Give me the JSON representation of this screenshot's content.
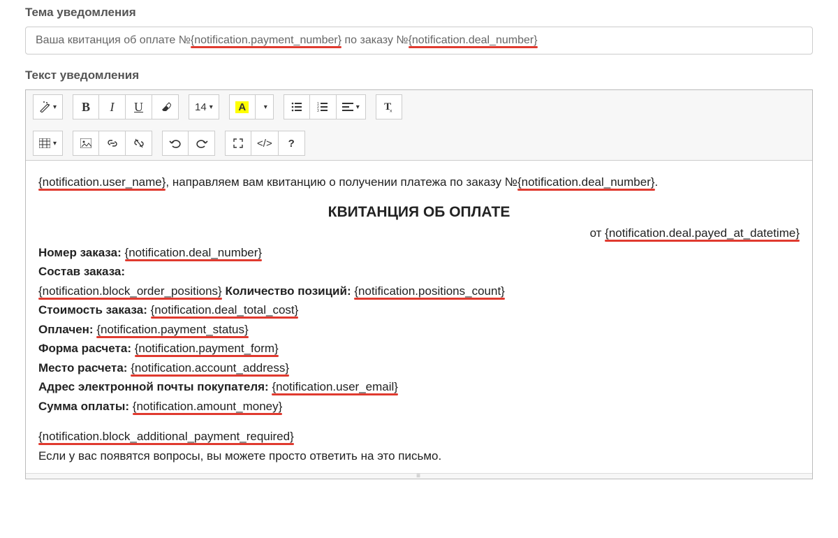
{
  "labels": {
    "subject": "Тема уведомления",
    "body": "Текст уведомления"
  },
  "subject": {
    "pre1": "Ваша квитанция об оплате №",
    "var1": "{notification.payment_number}",
    "mid": " по заказу №",
    "var2": "{notification.deal_number}"
  },
  "toolbar": {
    "fontsize": "14",
    "fontcolor_letter": "A",
    "code": "</>",
    "help": "?",
    "clear_t": "T"
  },
  "body": {
    "greet_var": "{notification.user_name}",
    "greet_rest": ", направляем вам квитанцию о получении платежа по заказу №",
    "greet_var2": "{notification.deal_number}",
    "greet_dot": ".",
    "title": "КВИТАНЦИЯ ОБ ОПЛАТЕ",
    "date_pre": "от ",
    "date_var": "{notification.deal.payed_at_datetime}",
    "rows": {
      "r1_lbl": "Номер заказа:",
      "r1_var": "{notification.deal_number}",
      "r2_lbl": "Состав заказа:",
      "r3_var": "{notification.block_order_positions}",
      "r3_lbl2": "Количество позиций:",
      "r3_var2": "{notification.positions_count}",
      "r4_lbl": "Стоимость заказа:",
      "r4_var": "{notification.deal_total_cost}",
      "r5_lbl": "Оплачен:",
      "r5_var": "{notification.payment_status}",
      "r6_lbl": "Форма расчета:",
      "r6_var": "{notification.payment_form}",
      "r7_lbl": "Место расчета:",
      "r7_var": "{notification.account_address}",
      "r8_lbl": "Адрес электронной почты покупателя:",
      "r8_var": "{notification.user_email}",
      "r9_lbl": "Сумма оплаты:",
      "r9_var": "{notification.amount_money}",
      "r10_var": "{notification.block_additional_payment_required}",
      "footer": "Если у вас появятся вопросы, вы можете просто ответить на это письмо."
    }
  }
}
